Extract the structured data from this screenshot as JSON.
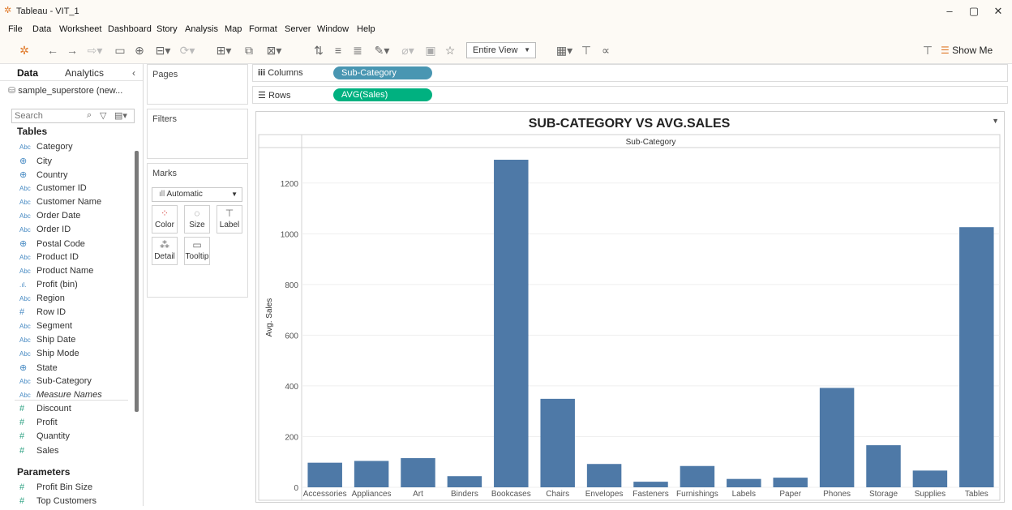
{
  "window": {
    "title": "Tableau - VIT_1"
  },
  "menu": [
    "File",
    "Data",
    "Worksheet",
    "Dashboard",
    "Story",
    "Analysis",
    "Map",
    "Format",
    "Server",
    "Window",
    "Help"
  ],
  "toolbar": {
    "view_mode": "Entire View",
    "show_me": "Show Me"
  },
  "datapane": {
    "tabs": [
      "Data",
      "Analytics"
    ],
    "datasource": "sample_superstore (new...",
    "search_placeholder": "Search",
    "tables_header": "Tables",
    "dimensions": [
      {
        "type": "Abc",
        "name": "Category"
      },
      {
        "type": "globe",
        "name": "City"
      },
      {
        "type": "globe",
        "name": "Country"
      },
      {
        "type": "Abc",
        "name": "Customer ID"
      },
      {
        "type": "Abc",
        "name": "Customer Name"
      },
      {
        "type": "Abc",
        "name": "Order Date"
      },
      {
        "type": "Abc",
        "name": "Order ID"
      },
      {
        "type": "globe",
        "name": "Postal Code"
      },
      {
        "type": "Abc",
        "name": "Product ID"
      },
      {
        "type": "Abc",
        "name": "Product Name"
      },
      {
        "type": "bin",
        "name": "Profit (bin)"
      },
      {
        "type": "Abc",
        "name": "Region"
      },
      {
        "type": "#",
        "name": "Row ID"
      },
      {
        "type": "Abc",
        "name": "Segment"
      },
      {
        "type": "Abc",
        "name": "Ship Date"
      },
      {
        "type": "Abc",
        "name": "Ship Mode"
      },
      {
        "type": "globe",
        "name": "State"
      },
      {
        "type": "Abc",
        "name": "Sub-Category"
      },
      {
        "type": "Abc",
        "name": "Measure Names"
      }
    ],
    "measures": [
      {
        "type": "#",
        "name": "Discount"
      },
      {
        "type": "#",
        "name": "Profit"
      },
      {
        "type": "#",
        "name": "Quantity"
      },
      {
        "type": "#",
        "name": "Sales"
      }
    ],
    "parameters_header": "Parameters",
    "parameters": [
      {
        "type": "#",
        "name": "Profit Bin Size"
      },
      {
        "type": "#",
        "name": "Top Customers"
      }
    ]
  },
  "cards": {
    "pages": "Pages",
    "filters": "Filters",
    "marks": "Marks",
    "mark_type": "Automatic",
    "mark_buttons": [
      "Color",
      "Size",
      "Label",
      "Detail",
      "Tooltip"
    ]
  },
  "shelves": {
    "columns_label": "Columns",
    "columns_pill": "Sub-Category",
    "rows_label": "Rows",
    "rows_pill": "AVG(Sales)"
  },
  "colors": {
    "bar": "#4e79a7",
    "columns_pill": "#4996b2",
    "rows_pill": "#00b180"
  },
  "chart_data": {
    "type": "bar",
    "title": "SUB-CATEGORY VS AVG.SALES",
    "column_header": "Sub-Category",
    "ylabel": "Avg. Sales",
    "ylim": [
      0,
      1340
    ],
    "yticks": [
      0,
      200,
      400,
      600,
      800,
      1000,
      1200
    ],
    "grid": true,
    "categories": [
      "Accessories",
      "Appliances",
      "Art",
      "Binders",
      "Bookcases",
      "Chairs",
      "Envelopes",
      "Fasteners",
      "Furnishings",
      "Labels",
      "Paper",
      "Phones",
      "Storage",
      "Supplies",
      "Tables"
    ],
    "values": [
      97,
      104,
      115,
      44,
      1292,
      349,
      92,
      22,
      84,
      33,
      38,
      392,
      166,
      66,
      1026
    ]
  }
}
